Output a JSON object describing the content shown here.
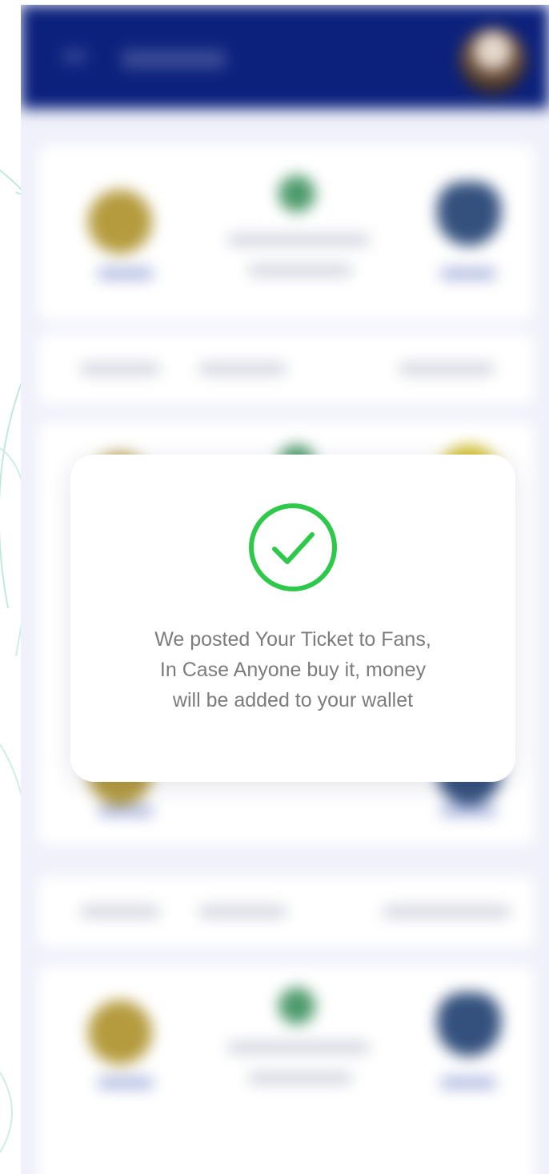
{
  "dialog": {
    "icon": "check-circle-icon",
    "message_lines": [
      "We posted Your Ticket to Fans,",
      "In Case Anyone buy it, money",
      "will be added to your wallet"
    ]
  },
  "colors": {
    "app_bar": "#0b217c",
    "success_green": "#2ec94a",
    "message_text": "#7c7c7c",
    "backdrop": "#f0f1fa"
  },
  "background": {
    "header": {
      "menu_icon": "menu-icon",
      "avatar": "user-avatar"
    },
    "match_cards": [
      {
        "home_crest": "gold-club-crest",
        "center_crest": "green-club-crest",
        "away_crest": "navy-club-crest"
      },
      {
        "home_crest": "gold-club-crest",
        "center_crest": "green-club-crest",
        "away_crest": "yellow-club-crest"
      },
      {
        "home_crest": "gold-club-crest",
        "center_crest": "green-club-crest",
        "away_crest": "navy-club-crest"
      }
    ]
  }
}
